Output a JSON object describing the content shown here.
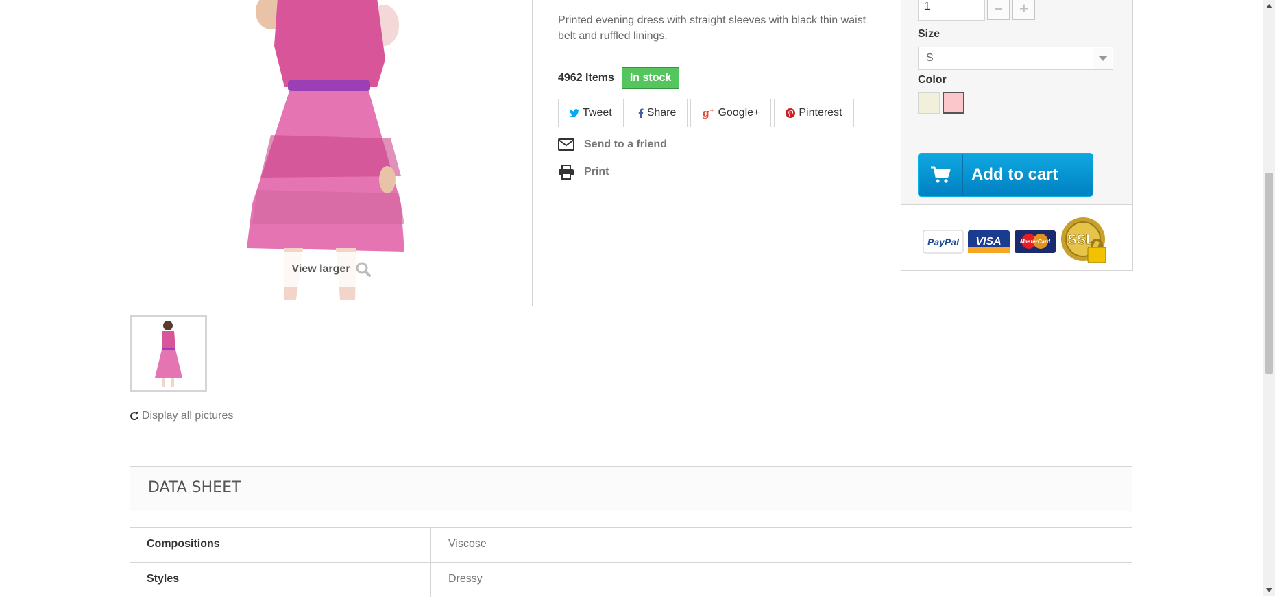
{
  "product": {
    "image_alt": "Printed Dress",
    "view_larger_label": "View larger",
    "display_all_label": "Display all pictures",
    "description": "Printed evening dress with straight sleeves with black thin waist belt and ruffled linings.",
    "quantity_available": "4962",
    "quantity_unit": "Items",
    "availability": "In stock"
  },
  "social": {
    "tweet": "Tweet",
    "share": "Share",
    "google": "Google+",
    "pinterest": "Pinterest"
  },
  "actions": {
    "send_to_friend": "Send to a friend",
    "print": "Print"
  },
  "buy_box": {
    "quantity_value": "1",
    "size_label": "Size",
    "size_value": "S",
    "color_label": "Color",
    "colors": [
      "#f1f0da",
      "#fbc7cb"
    ],
    "add_to_cart": "Add to cart",
    "payment_logos": [
      "PayPal",
      "VISA",
      "MasterCard",
      "SSL"
    ]
  },
  "data_sheet": {
    "title": "DATA SHEET",
    "rows": [
      {
        "key": "Compositions",
        "value": "Viscose"
      },
      {
        "key": "Styles",
        "value": "Dressy"
      }
    ]
  },
  "colors": {
    "in_stock_green": "#55c65e",
    "cart_blue": "#0092d6",
    "twitter": "#00aaf0",
    "facebook": "#435f9f",
    "google": "#e04b34",
    "pinterest": "#ce1f21"
  }
}
